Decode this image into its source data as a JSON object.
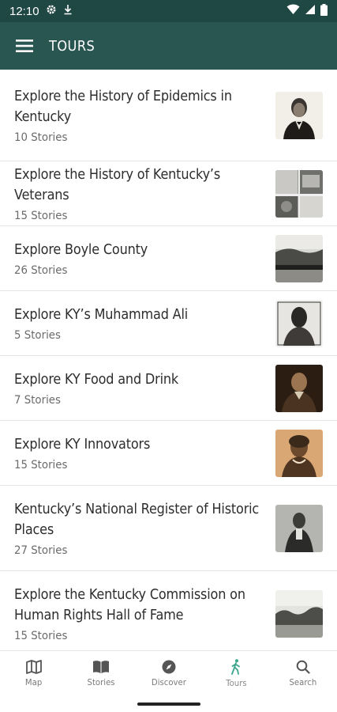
{
  "status": {
    "time": "12:10"
  },
  "app_bar": {
    "title": "TOURS"
  },
  "tours": [
    {
      "title": "Explore the History of Epidemics in Kentucky",
      "count": "10 Stories"
    },
    {
      "title": "Explore the History of Kentucky’s Veterans",
      "count": "15 Stories"
    },
    {
      "title": "Explore Boyle County",
      "count": "26 Stories"
    },
    {
      "title": "Explore KY’s Muhammad Ali",
      "count": "5 Stories"
    },
    {
      "title": "Explore KY Food and Drink",
      "count": "7 Stories"
    },
    {
      "title": "Explore KY Innovators",
      "count": "15 Stories"
    },
    {
      "title": "Kentucky’s National Register of Historic Places",
      "count": "27 Stories"
    },
    {
      "title": "Explore the Kentucky Commission on Human Rights Hall of Fame",
      "count": "15 Stories"
    }
  ],
  "bottom_nav": [
    {
      "label": "Map",
      "icon": "map-icon"
    },
    {
      "label": "Stories",
      "icon": "book-icon"
    },
    {
      "label": "Discover",
      "icon": "compass-icon"
    },
    {
      "label": "Tours",
      "icon": "walking-icon",
      "active": true
    },
    {
      "label": "Search",
      "icon": "search-icon"
    }
  ],
  "colors": {
    "primary": "#2a5652",
    "status_bar": "#1f4744",
    "active_icon": "#3aa58c"
  }
}
